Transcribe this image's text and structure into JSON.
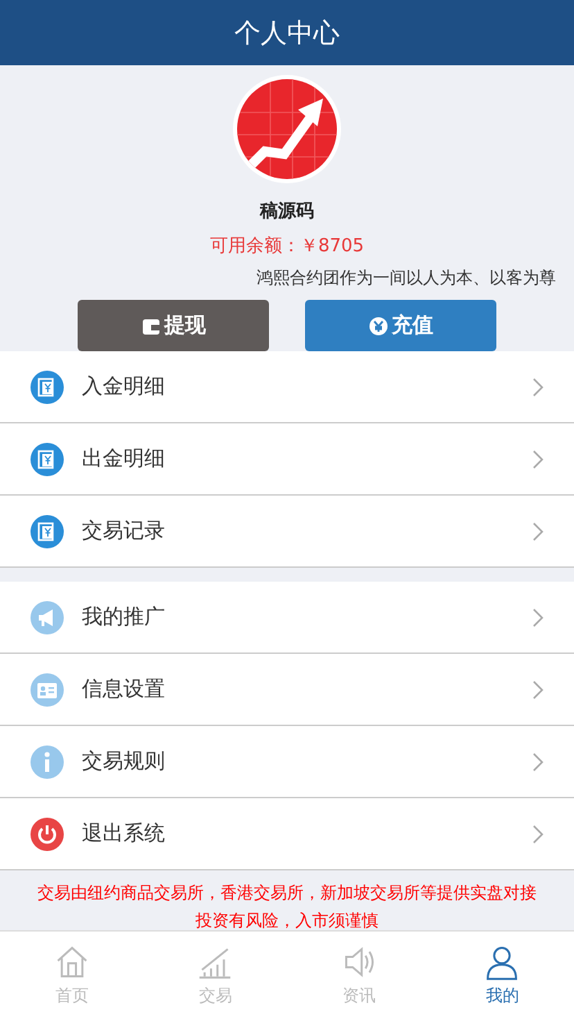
{
  "header": {
    "title": "个人中心"
  },
  "profile": {
    "name": "稿源码",
    "balance": "可用余额：￥8705",
    "marquee": "鸿熙合约团作为一间以人为本、以客为尊"
  },
  "actions": [
    {
      "label": "提现",
      "kind": "withdraw"
    },
    {
      "label": "充值",
      "kind": "deposit"
    }
  ],
  "menu_groups": [
    [
      {
        "label": "入金明细",
        "kind": "money"
      },
      {
        "label": "出金明细",
        "kind": "money"
      },
      {
        "label": "交易记录",
        "kind": "money"
      }
    ],
    [
      {
        "label": "我的推广",
        "kind": "megaphone"
      },
      {
        "label": "信息设置",
        "kind": "card"
      },
      {
        "label": "交易规则",
        "kind": "info"
      },
      {
        "label": "退出系统",
        "kind": "power"
      }
    ]
  ],
  "disclaimer": [
    "交易由纽约商品交易所，香港交易所，新加坡交易所等提供实盘对接",
    "投资有风险，入市须谨慎"
  ],
  "tabs": [
    {
      "label": "首页",
      "kind": "home",
      "selected": false
    },
    {
      "label": "交易",
      "kind": "chart",
      "selected": false
    },
    {
      "label": "资讯",
      "kind": "speaker",
      "selected": false
    },
    {
      "label": "我的",
      "kind": "person",
      "selected": true
    }
  ]
}
